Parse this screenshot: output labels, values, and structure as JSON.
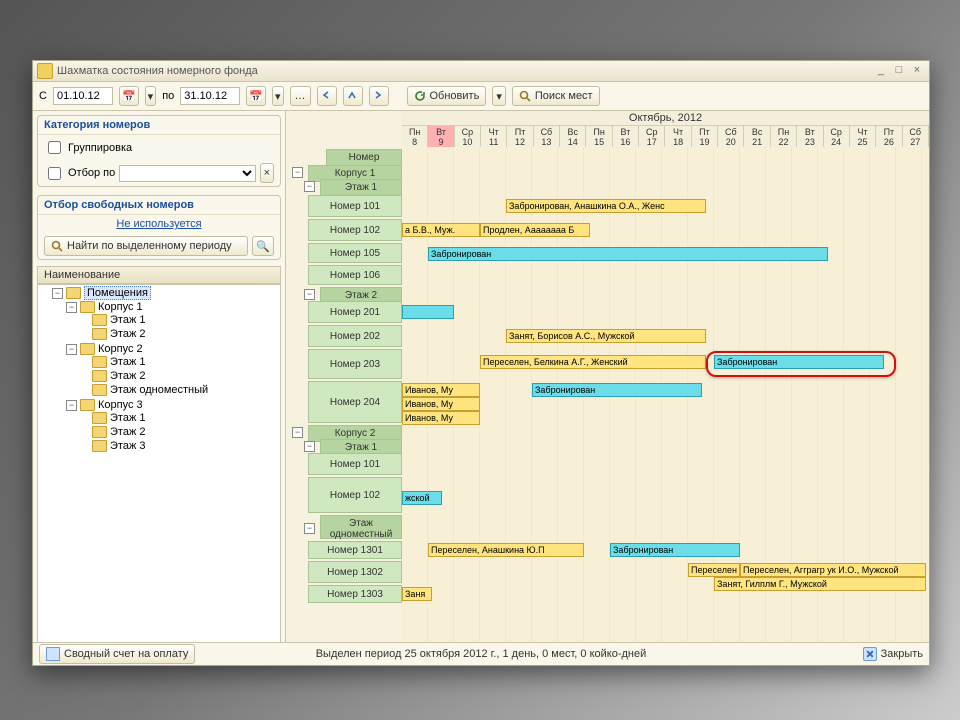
{
  "title": "Шахматка состояния номерного фонда",
  "toolbar": {
    "from_lbl": "С",
    "from": "01.10.12",
    "to_lbl": "по",
    "to": "31.10.12",
    "refresh": "Обновить",
    "search": "Поиск мест"
  },
  "categories": {
    "title": "Категория номеров",
    "group": "Группировка",
    "filter": "Отбор по"
  },
  "freefilter": {
    "title": "Отбор свободных номеров",
    "notused": "Не используется",
    "findperiod": "Найти по выделенному периоду"
  },
  "treehdr": "Наименование",
  "tree": {
    "root": "Помещения",
    "k1": "Корпус 1",
    "k2": "Корпус 2",
    "k3": "Корпус 3",
    "e1": "Этаж 1",
    "e2": "Этаж 2",
    "e3": "Этаж 3",
    "esingle": "Этаж одноместный"
  },
  "month": "Октябрь, 2012",
  "days": [
    {
      "w": "Пн",
      "d": "8"
    },
    {
      "w": "Вт",
      "d": "9",
      "today": true
    },
    {
      "w": "Ср",
      "d": "10"
    },
    {
      "w": "Чт",
      "d": "11"
    },
    {
      "w": "Пт",
      "d": "12"
    },
    {
      "w": "Сб",
      "d": "13"
    },
    {
      "w": "Вс",
      "d": "14"
    },
    {
      "w": "Пн",
      "d": "15"
    },
    {
      "w": "Вт",
      "d": "16"
    },
    {
      "w": "Ср",
      "d": "17"
    },
    {
      "w": "Чт",
      "d": "18"
    },
    {
      "w": "Пт",
      "d": "19"
    },
    {
      "w": "Сб",
      "d": "20"
    },
    {
      "w": "Вс",
      "d": "21"
    },
    {
      "w": "Пн",
      "d": "22"
    },
    {
      "w": "Вт",
      "d": "23"
    },
    {
      "w": "Ср",
      "d": "24"
    },
    {
      "w": "Чт",
      "d": "25"
    },
    {
      "w": "Пт",
      "d": "26"
    },
    {
      "w": "Сб",
      "d": "27"
    }
  ],
  "rows": {
    "nomer": "Номер",
    "k1": "Корпус 1",
    "e1": "Этаж 1",
    "n101": "Номер 101",
    "n102": "Номер 102",
    "n105": "Номер 105",
    "n106": "Номер 106",
    "e2": "Этаж 2",
    "n201": "Номер 201",
    "n202": "Номер 202",
    "n203": "Номер 203",
    "n204": "Номер 204",
    "k2": "Корпус 2",
    "e1b": "Этаж 1",
    "n101b": "Номер 101",
    "n102b": "Номер 102",
    "esingle": "Этаж одноместный",
    "n1301": "Номер 1301",
    "n1302": "Номер 1302",
    "n1303": "Номер 1303"
  },
  "bars": {
    "r101a": "Забронирован, Анашкина О.А., Женс",
    "r102a": "а Б.В., Муж.",
    "r102b": "Продлен, Аааааааа Б",
    "r105": "Забронирован",
    "r201": "",
    "r202": "Занят, Борисов А.С., Мужской",
    "r203a": "Переселен, Белкина А.Г., Женский",
    "r203b": "Забронирован",
    "r204a": "Иванов, Му",
    "r204b": "Иванов, Му",
    "r204c": "Иванов, Му",
    "r204d": "Забронирован",
    "r102b1": "жской",
    "r1301a": "Переселен, Анашкина Ю.П",
    "r1301b": "Забронирован",
    "r1302a": "Переселен",
    "r1302b": "Переселен, Агграгр ук И.О., Мужской",
    "r1302c": "Занят, Гилплм Г., Мужской",
    "r1303": "Заня"
  },
  "footer": {
    "left": "Сводный счет на оплату",
    "center": "Выделен период 25 октября 2012 г., 1 день, 0 мест, 0 койко-дней",
    "close": "Закрыть"
  }
}
